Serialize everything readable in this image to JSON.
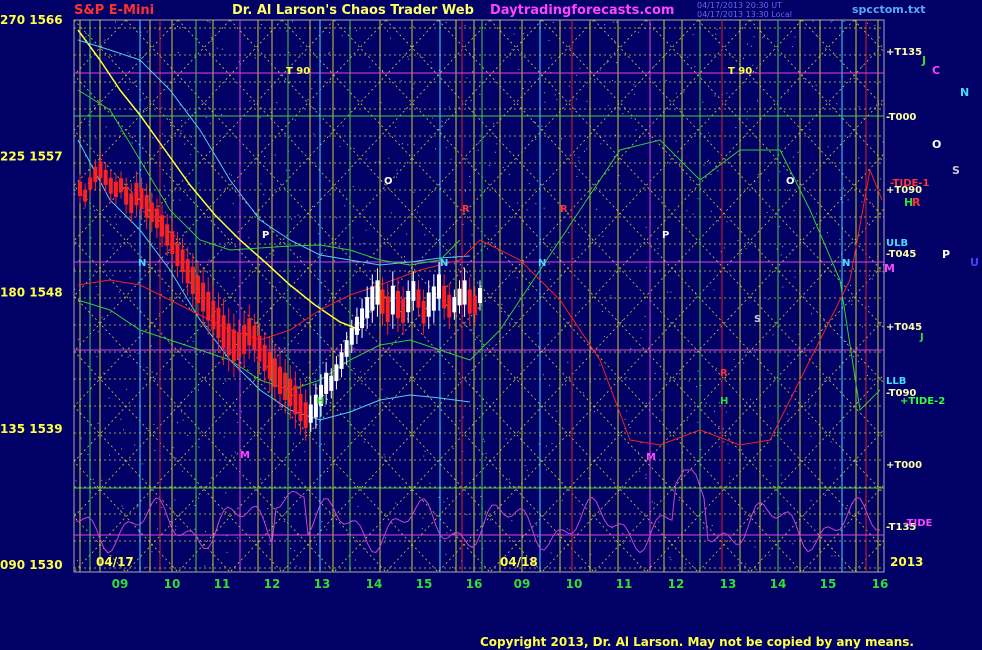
{
  "header": {
    "symbol": "S&P E-Mini",
    "title": "Dr. Al Larson's Chaos Trader Web",
    "site": "Daytradingforecasts.com",
    "file": "spcctom.txt",
    "timestamps": [
      "04/17/2013 20:30 UT",
      "04/17/2013 13:30 Local"
    ]
  },
  "copyright": "Copyright 2013, Dr. Al Larson. May not be copied by any means.",
  "colors": {
    "background": "#000066",
    "price_up": "#ffffff",
    "price_down": "#ff2020",
    "grid_yellow": "#cccc33",
    "grid_green": "#44cc44",
    "grid_cyan": "#44ddff",
    "grid_magenta": "#dd44dd",
    "grid_red": "#dd2222",
    "ma_yellow": "#ffff33",
    "band_cyan": "#55ccee",
    "band_green": "#33cc33",
    "tide_red": "#ee2222",
    "oscillator": "#cc44cc"
  },
  "chart_data": {
    "type": "candlestick",
    "y_axis_labels": [
      "270 1566",
      "225 1557",
      "180 1548",
      "135 1539",
      "090 1530"
    ],
    "y_axis_values": [
      1566,
      1557,
      1548,
      1539,
      1530
    ],
    "ylim": [
      1530,
      1567
    ],
    "x_tick_labels": [
      "09",
      "10",
      "11",
      "12",
      "13",
      "14",
      "15",
      "16",
      "09",
      "10",
      "11",
      "12",
      "13",
      "14",
      "15",
      "16"
    ],
    "date_labels": [
      "04/17",
      "04/18",
      "2013"
    ],
    "right_labels": [
      "+T135",
      "-T000",
      "-TIDE-1",
      "+T090",
      "ULB",
      "-T045",
      "+T045",
      "LLB",
      "-T090",
      "+TIDE-2",
      "+T000",
      "-T135",
      "-TIDE"
    ],
    "planet_letters": [
      "J",
      "C",
      "N",
      "O",
      "S",
      "H",
      "R",
      "P",
      "U",
      "M"
    ],
    "in_chart_labels": [
      "T 90",
      "T 90",
      "O",
      "P",
      "N",
      "N",
      "N",
      "N",
      "R",
      "R",
      "P",
      "O",
      "S",
      "H",
      "R",
      "H",
      "M",
      "M",
      "J"
    ],
    "price_path": [
      [
        1555.8,
        1553.9
      ],
      [
        1555.2,
        1553.6
      ],
      [
        1556.0,
        1554.4
      ],
      [
        1556.8,
        1554.8
      ],
      [
        1557.2,
        1555.0
      ],
      [
        1556.6,
        1554.6
      ],
      [
        1556.1,
        1554.0
      ],
      [
        1555.8,
        1553.8
      ],
      [
        1556.0,
        1554.2
      ],
      [
        1555.6,
        1553.2
      ],
      [
        1555.2,
        1552.6
      ],
      [
        1556.0,
        1553.0
      ],
      [
        1555.6,
        1552.8
      ],
      [
        1555.2,
        1552.2
      ],
      [
        1554.6,
        1552.0
      ],
      [
        1554.2,
        1551.6
      ],
      [
        1553.8,
        1551.0
      ],
      [
        1553.2,
        1550.4
      ],
      [
        1552.8,
        1549.8
      ],
      [
        1552.0,
        1549.0
      ],
      [
        1551.6,
        1548.6
      ],
      [
        1551.0,
        1547.8
      ],
      [
        1550.6,
        1547.0
      ],
      [
        1550.0,
        1546.4
      ],
      [
        1549.6,
        1545.8
      ],
      [
        1549.0,
        1545.2
      ],
      [
        1548.4,
        1544.6
      ],
      [
        1548.0,
        1544.0
      ],
      [
        1547.6,
        1543.2
      ],
      [
        1547.0,
        1542.8
      ],
      [
        1546.6,
        1542.4
      ],
      [
        1546.2,
        1542.8
      ],
      [
        1546.8,
        1543.0
      ],
      [
        1547.2,
        1543.6
      ],
      [
        1546.6,
        1543.4
      ],
      [
        1546.0,
        1542.6
      ],
      [
        1545.4,
        1542.0
      ],
      [
        1545.0,
        1541.4
      ],
      [
        1544.6,
        1540.8
      ],
      [
        1544.0,
        1540.4
      ],
      [
        1543.6,
        1540.0
      ],
      [
        1543.2,
        1539.6
      ],
      [
        1542.8,
        1539.0
      ],
      [
        1542.2,
        1538.6
      ],
      [
        1541.6,
        1538.2
      ],
      [
        1541.2,
        1538.8
      ],
      [
        1542.0,
        1539.0
      ],
      [
        1542.6,
        1539.8
      ],
      [
        1543.4,
        1540.6
      ],
      [
        1543.0,
        1541.0
      ],
      [
        1543.8,
        1541.6
      ],
      [
        1544.6,
        1542.4
      ],
      [
        1545.4,
        1543.2
      ],
      [
        1546.2,
        1544.0
      ],
      [
        1547.0,
        1544.6
      ],
      [
        1547.6,
        1545.0
      ],
      [
        1548.4,
        1545.6
      ],
      [
        1549.2,
        1546.0
      ],
      [
        1549.6,
        1546.4
      ],
      [
        1549.0,
        1545.8
      ],
      [
        1548.6,
        1545.2
      ],
      [
        1549.4,
        1545.6
      ],
      [
        1549.0,
        1545.4
      ],
      [
        1548.4,
        1545.2
      ],
      [
        1548.8,
        1546.0
      ],
      [
        1549.4,
        1546.8
      ],
      [
        1548.8,
        1546.4
      ],
      [
        1548.2,
        1545.2
      ],
      [
        1548.8,
        1545.6
      ],
      [
        1549.2,
        1546.0
      ],
      [
        1550.0,
        1546.8
      ],
      [
        1549.2,
        1546.2
      ],
      [
        1548.6,
        1545.6
      ],
      [
        1548.2,
        1546.2
      ],
      [
        1548.8,
        1546.6
      ],
      [
        1549.6,
        1546.4
      ],
      [
        1549.0,
        1545.8
      ],
      [
        1548.4,
        1546.0
      ],
      [
        1548.8,
        1546.8
      ]
    ]
  }
}
